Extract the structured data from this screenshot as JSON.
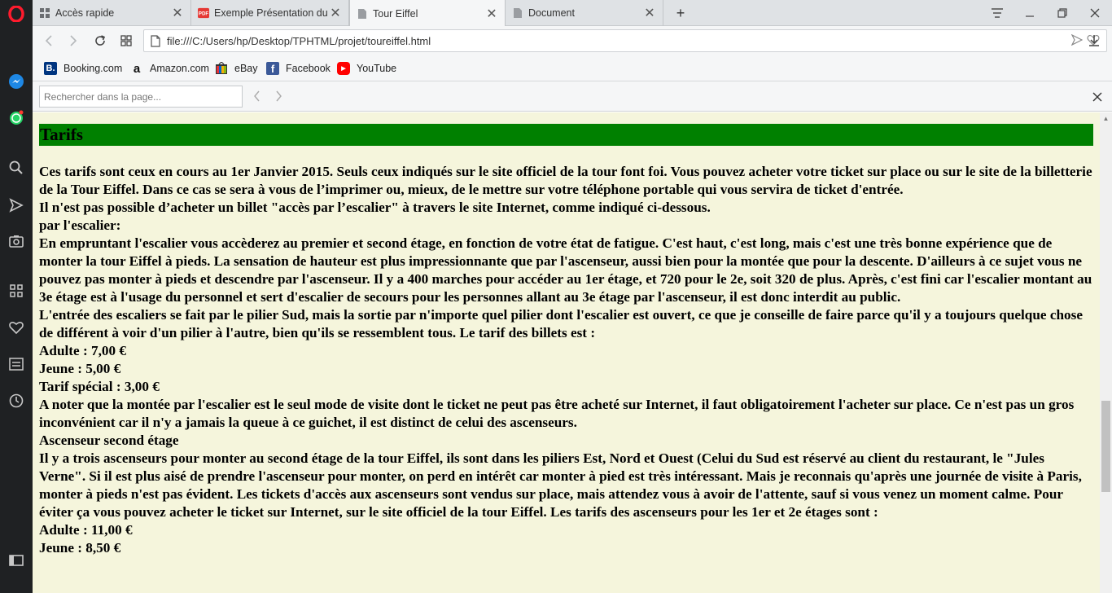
{
  "browser": {
    "tabs": [
      {
        "label": "Accès rapide",
        "icon": "grid-icon"
      },
      {
        "label": "Exemple Présentation du p",
        "icon": "pdf-icon"
      },
      {
        "label": "Tour Eiffel",
        "icon": "page-icon",
        "active": true
      },
      {
        "label": "Document",
        "icon": "page-icon"
      }
    ],
    "address": "file:///C:/Users/hp/Desktop/TPHTML/projet/toureiffel.html",
    "bookmarks": [
      {
        "label": "Booking.com",
        "icon": "booking-icon",
        "glyph": "B.",
        "color": "#003580"
      },
      {
        "label": "Amazon.com",
        "icon": "amazon-icon",
        "glyph": "a",
        "color": "#ffffff"
      },
      {
        "label": "eBay",
        "icon": "ebay-icon",
        "glyph": "",
        "color": "#e53238"
      },
      {
        "label": "Facebook",
        "icon": "facebook-icon",
        "glyph": "f",
        "color": "#3b5998"
      },
      {
        "label": "YouTube",
        "icon": "youtube-icon",
        "glyph": "▶",
        "color": "#ff0000"
      }
    ],
    "find": {
      "placeholder": "Rechercher dans la page..."
    }
  },
  "page": {
    "heading": "Tarifs",
    "heading_color": "#008000",
    "background": "#f5f5dc",
    "lines": [
      "Ces tarifs sont ceux en cours au 1er Janvier 2015. Seuls ceux indiqués sur le site officiel de la tour font foi. Vous pouvez acheter votre ticket sur place ou sur le site de la billetterie de la Tour Eiffel. Dans ce cas se sera à vous de l’imprimer ou, mieux, de le mettre sur votre téléphone portable qui vous servira de ticket d'entrée.",
      "Il n'est pas possible d’acheter un billet \"accès par l’escalier\" à travers le site Internet, comme indiqué ci-dessous.",
      "par l'escalier:",
      "En empruntant l'escalier vous accèderez au premier et second étage, en fonction de votre état de fatigue. C'est haut, c'est long, mais c'est une très bonne expérience que de monter la tour Eiffel à pieds. La sensation de hauteur est plus impressionnante que par l'ascenseur, aussi bien pour la montée que pour la descente. D'ailleurs à ce sujet vous ne pouvez pas monter à pieds et descendre par l'ascenseur. Il y a 400 marches pour accéder au 1er étage, et 720 pour le 2e, soit 320 de plus. Après, c'est fini car l'escalier montant au 3e étage est à l'usage du personnel et sert d'escalier de secours pour les personnes allant au 3e étage par l'ascenseur, il est donc interdit au public.",
      "L'entrée des escaliers se fait par le pilier Sud, mais la sortie par n'importe quel pilier dont l'escalier est ouvert, ce que je conseille de faire parce qu'il y a toujours quelque chose de différent à voir d'un pilier à l'autre, bien qu'ils se ressemblent tous. Le tarif des billets est :",
      "Adulte : 7,00 €",
      "Jeune : 5,00 €",
      "Tarif spécial : 3,00 €",
      "A noter que la montée par l'escalier est le seul mode de visite dont le ticket ne peut pas être acheté sur Internet, il faut obligatoirement l'acheter sur place. Ce n'est pas un gros inconvénient car il n'y a jamais la queue à ce guichet, il est distinct de celui des ascenseurs.",
      "Ascenseur second étage",
      "Il y a trois ascenseurs pour monter au second étage de la tour Eiffel, ils sont dans les piliers Est, Nord et Ouest (Celui du Sud est réservé au client du restaurant, le \"Jules Verne\". Si il est plus aisé de prendre l'ascenseur pour monter, on perd en intérêt car monter à pied est très intéressant. Mais je reconnais qu'après une journée de visite à Paris, monter à pieds n'est pas évident. Les tickets d'accès aux ascenseurs sont vendus sur place, mais attendez vous à avoir de l'attente, sauf si vous venez un moment calme. Pour éviter ça vous pouvez acheter le ticket sur Internet, sur le site officiel de la tour Eiffel. Les tarifs des ascenseurs pour les 1er et 2e étages sont :",
      "Adulte : 11,00 €",
      "Jeune : 8,50 €"
    ]
  }
}
